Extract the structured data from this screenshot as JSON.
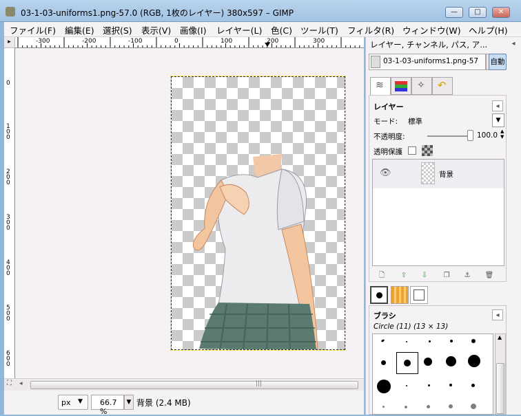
{
  "window": {
    "title": "03-1-03-uniforms1.png-57.0 (RGB, 1枚のレイヤー) 380x597 – GIMP",
    "minimize": "—",
    "maximize": "□",
    "close": "✕"
  },
  "menu": [
    "ファイル(F)",
    "編集(E)",
    "選択(S)",
    "表示(V)",
    "画像(I)",
    "レイヤー(L)",
    "色(C)",
    "ツール(T)",
    "フィルタ(R)",
    "ウィンドウ(W)",
    "ヘルプ(H)"
  ],
  "ruler": {
    "h_ticks": [
      "-300",
      "-200",
      "-100",
      "0",
      "100",
      "200",
      "300"
    ],
    "v_ticks": [
      "0",
      "100",
      "200",
      "300",
      "400",
      "500",
      "600"
    ]
  },
  "status": {
    "unit": "px",
    "zoom": "66.7 %",
    "info": "背景 (2.4 MB)"
  },
  "dock": {
    "header_title": "レイヤー, チャンネル, パス, ア...",
    "image_select": "03-1-03-uniforms1.png-57",
    "auto_button": "自動",
    "layers": {
      "title": "レイヤー",
      "mode_label": "モード:",
      "mode_value": "標準",
      "opacity_label": "不透明度:",
      "opacity_value": "100.0",
      "opacity_fraction": 1.0,
      "lock_label": "透明保護",
      "layer_name": "背景"
    },
    "brushes": {
      "title": "ブラシ",
      "current": "Circle (11) (13 × 13)"
    }
  }
}
